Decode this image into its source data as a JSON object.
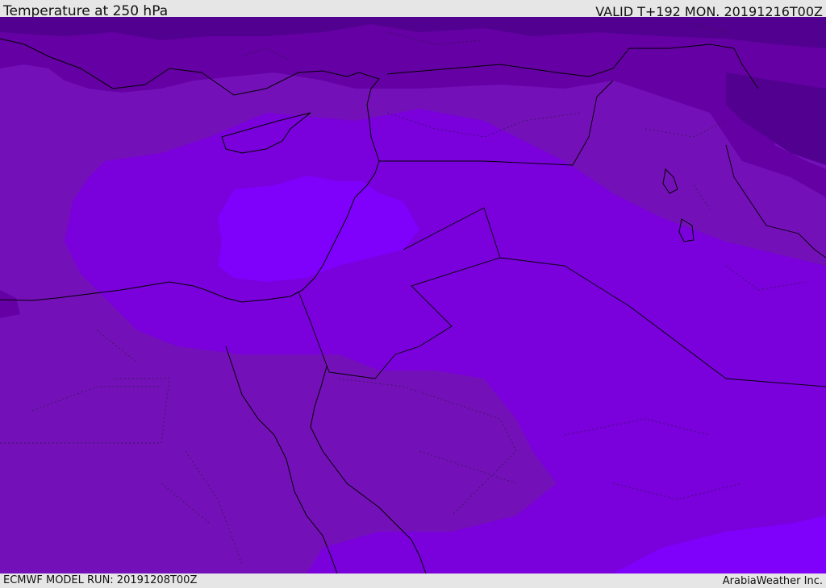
{
  "header": {
    "title": "Temperature at 250 hPa",
    "valid": "VALID T+192 MON. 20191216T00Z"
  },
  "footer": {
    "model_run": "ECMWF MODEL RUN: 20191208T00Z",
    "credit": "ArabiaWeather Inc."
  },
  "map": {
    "colors": {
      "band_darkest": "#52008f",
      "band_dark": "#6500a4",
      "band_mid": "#7410b8",
      "band_light": "#7a00dc",
      "band_lightest": "#7f00fb",
      "coastline": "#000000"
    }
  }
}
